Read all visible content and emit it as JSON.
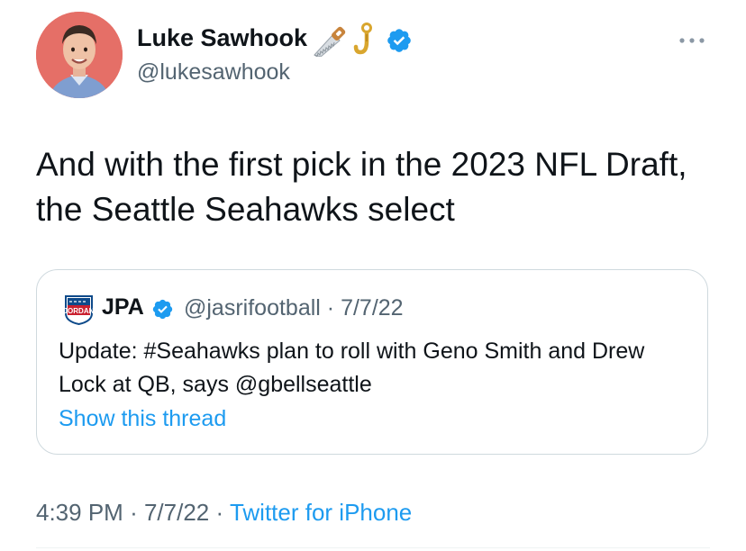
{
  "author": {
    "name": "Luke Sawhook",
    "handle": "@lukesawhook",
    "name_emojis": [
      "saw-icon",
      "hook-icon"
    ],
    "verified": true
  },
  "tweet": {
    "text": "And with the first pick in the 2023 NFL Draft, the Seattle Seahawks select",
    "time": "4:39 PM",
    "date": "7/7/22",
    "source": "Twitter for iPhone",
    "separator": "·"
  },
  "quoted_tweet": {
    "name": "JPA",
    "handle": "@jasrifootball",
    "date": "7/7/22",
    "separator": "·",
    "verified": true,
    "logo_text": "JORDAN",
    "text": "Update: #Seahawks plan to roll with Geno Smith and Drew Lock at QB, says @gbellseattle",
    "show_thread_label": "Show this thread"
  },
  "colors": {
    "link": "#1d9bf0",
    "secondary_text": "#536471",
    "avatar_bg": "#e56f67",
    "border": "#cfd9de"
  }
}
